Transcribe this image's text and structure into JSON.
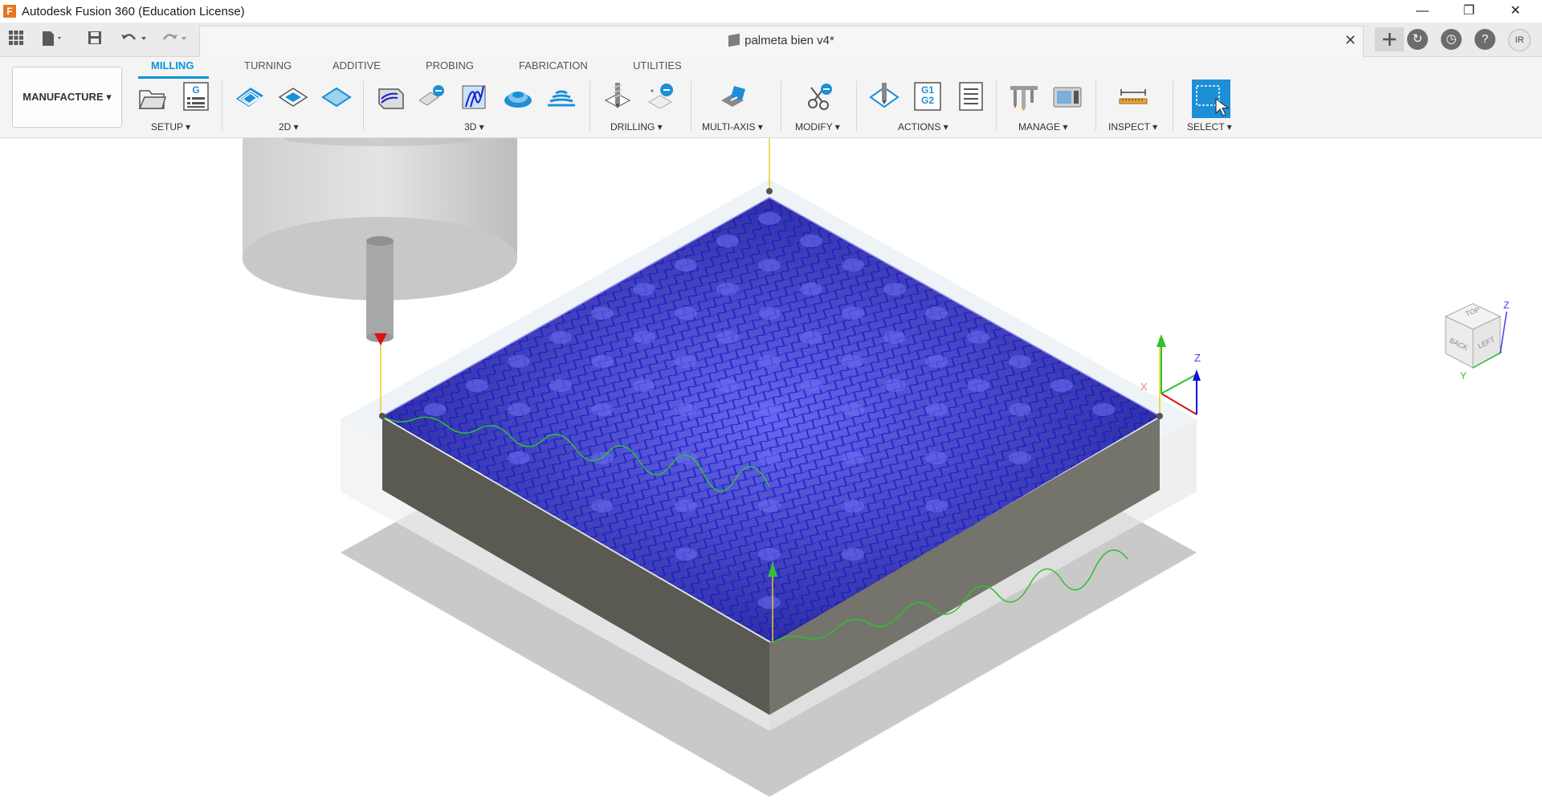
{
  "app": {
    "window_title": "Autodesk Fusion 360 (Education License)",
    "logo_letter": "F"
  },
  "window_controls": {
    "minimize": "—",
    "restore": "❐",
    "close": "✕"
  },
  "document": {
    "title": "palmeta bien v4*",
    "close_glyph": "✕"
  },
  "user": {
    "initials": "IR"
  },
  "workspace": {
    "label": "MANUFACTURE ▾"
  },
  "tabs": [
    {
      "label": "MILLING",
      "active": true
    },
    {
      "label": "TURNING"
    },
    {
      "label": "ADDITIVE"
    },
    {
      "label": "PROBING"
    },
    {
      "label": "FABRICATION"
    },
    {
      "label": "UTILITIES"
    }
  ],
  "groups": [
    {
      "label": "SETUP ▾"
    },
    {
      "label": "2D ▾"
    },
    {
      "label": "3D ▾"
    },
    {
      "label": "DRILLING ▾"
    },
    {
      "label": "MULTI-AXIS ▾"
    },
    {
      "label": "MODIFY ▾"
    },
    {
      "label": "ACTIONS ▾"
    },
    {
      "label": "MANAGE ▾"
    },
    {
      "label": "INSPECT ▾"
    },
    {
      "label": "SELECT ▾"
    }
  ],
  "nc_icon_text": {
    "g": "G",
    "g1": "G1",
    "g2": "G2"
  },
  "viewcube": {
    "top": "TOP",
    "back": "BACK",
    "left": "LEFT",
    "z": "Z",
    "y": "Y"
  },
  "triad": {
    "x": "X",
    "z": "Z"
  },
  "colors": {
    "accent": "#0696d7",
    "toolpath": "#1a1adb",
    "stock_side": "#6b6b62",
    "select_active": "#1c8fd6"
  }
}
